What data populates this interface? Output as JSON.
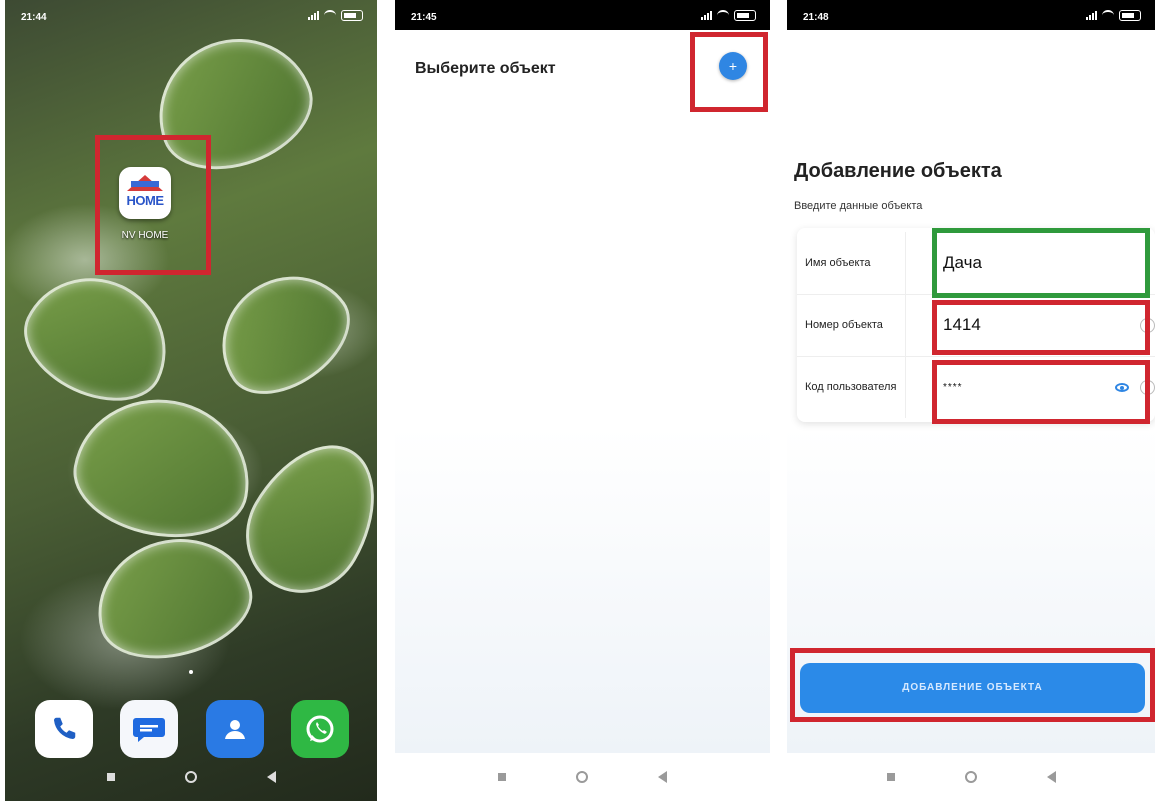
{
  "screen1": {
    "status": {
      "time": "21:44"
    },
    "app": {
      "label": "NV HOME",
      "icon_text": "HOME"
    },
    "dock": [
      {
        "name": "phone-icon"
      },
      {
        "name": "messages-icon"
      },
      {
        "name": "contacts-icon"
      },
      {
        "name": "whatsapp-icon"
      }
    ]
  },
  "screen2": {
    "status": {
      "time": "21:45"
    },
    "title": "Выберите объект",
    "add_button": "+"
  },
  "screen3": {
    "status": {
      "time": "21:48"
    },
    "title": "Добавление объекта",
    "subtitle": "Введите данные объекта",
    "fields": [
      {
        "label": "Имя объекта",
        "value": "Дача"
      },
      {
        "label": "Номер объекта",
        "value": "1414"
      },
      {
        "label": "Код пользователя",
        "value": "****"
      }
    ],
    "submit_label": "ДОБАВЛЕНИЕ ОБЪЕКТА"
  },
  "colors": {
    "accent": "#2b8ae8",
    "highlight_red": "#d0262f",
    "highlight_green": "#2f9a3c"
  }
}
